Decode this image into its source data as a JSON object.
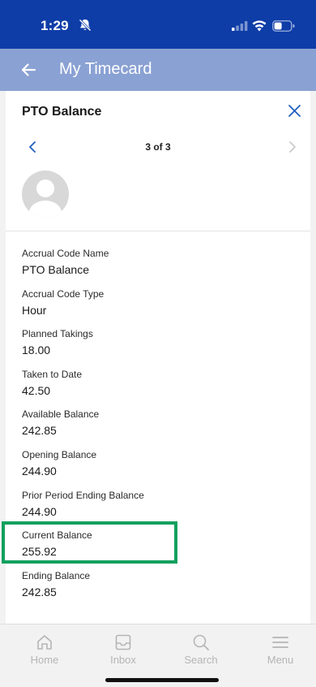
{
  "status_bar": {
    "time": "1:29"
  },
  "header": {
    "title": "My Timecard"
  },
  "panel": {
    "title": "PTO Balance",
    "pager": "3 of 3"
  },
  "fields": [
    {
      "label": "Accrual Code Name",
      "value": "PTO Balance"
    },
    {
      "label": "Accrual Code Type",
      "value": "Hour"
    },
    {
      "label": "Planned Takings",
      "value": "18.00"
    },
    {
      "label": "Taken to Date",
      "value": "42.50"
    },
    {
      "label": "Available Balance",
      "value": "242.85"
    },
    {
      "label": "Opening Balance",
      "value": "244.90"
    },
    {
      "label": "Prior Period Ending Balance",
      "value": "244.90"
    },
    {
      "label": "Current Balance",
      "value": "255.92"
    },
    {
      "label": "Ending Balance",
      "value": "242.85"
    }
  ],
  "tabs": [
    {
      "label": "Home",
      "icon": "home-icon"
    },
    {
      "label": "Inbox",
      "icon": "inbox-icon"
    },
    {
      "label": "Search",
      "icon": "search-icon"
    },
    {
      "label": "Menu",
      "icon": "menu-icon"
    }
  ],
  "colors": {
    "status_bar": "#0e3da8",
    "header": "#8aa1d3",
    "highlight": "#13a05f",
    "accent": "#1f5fbf"
  }
}
